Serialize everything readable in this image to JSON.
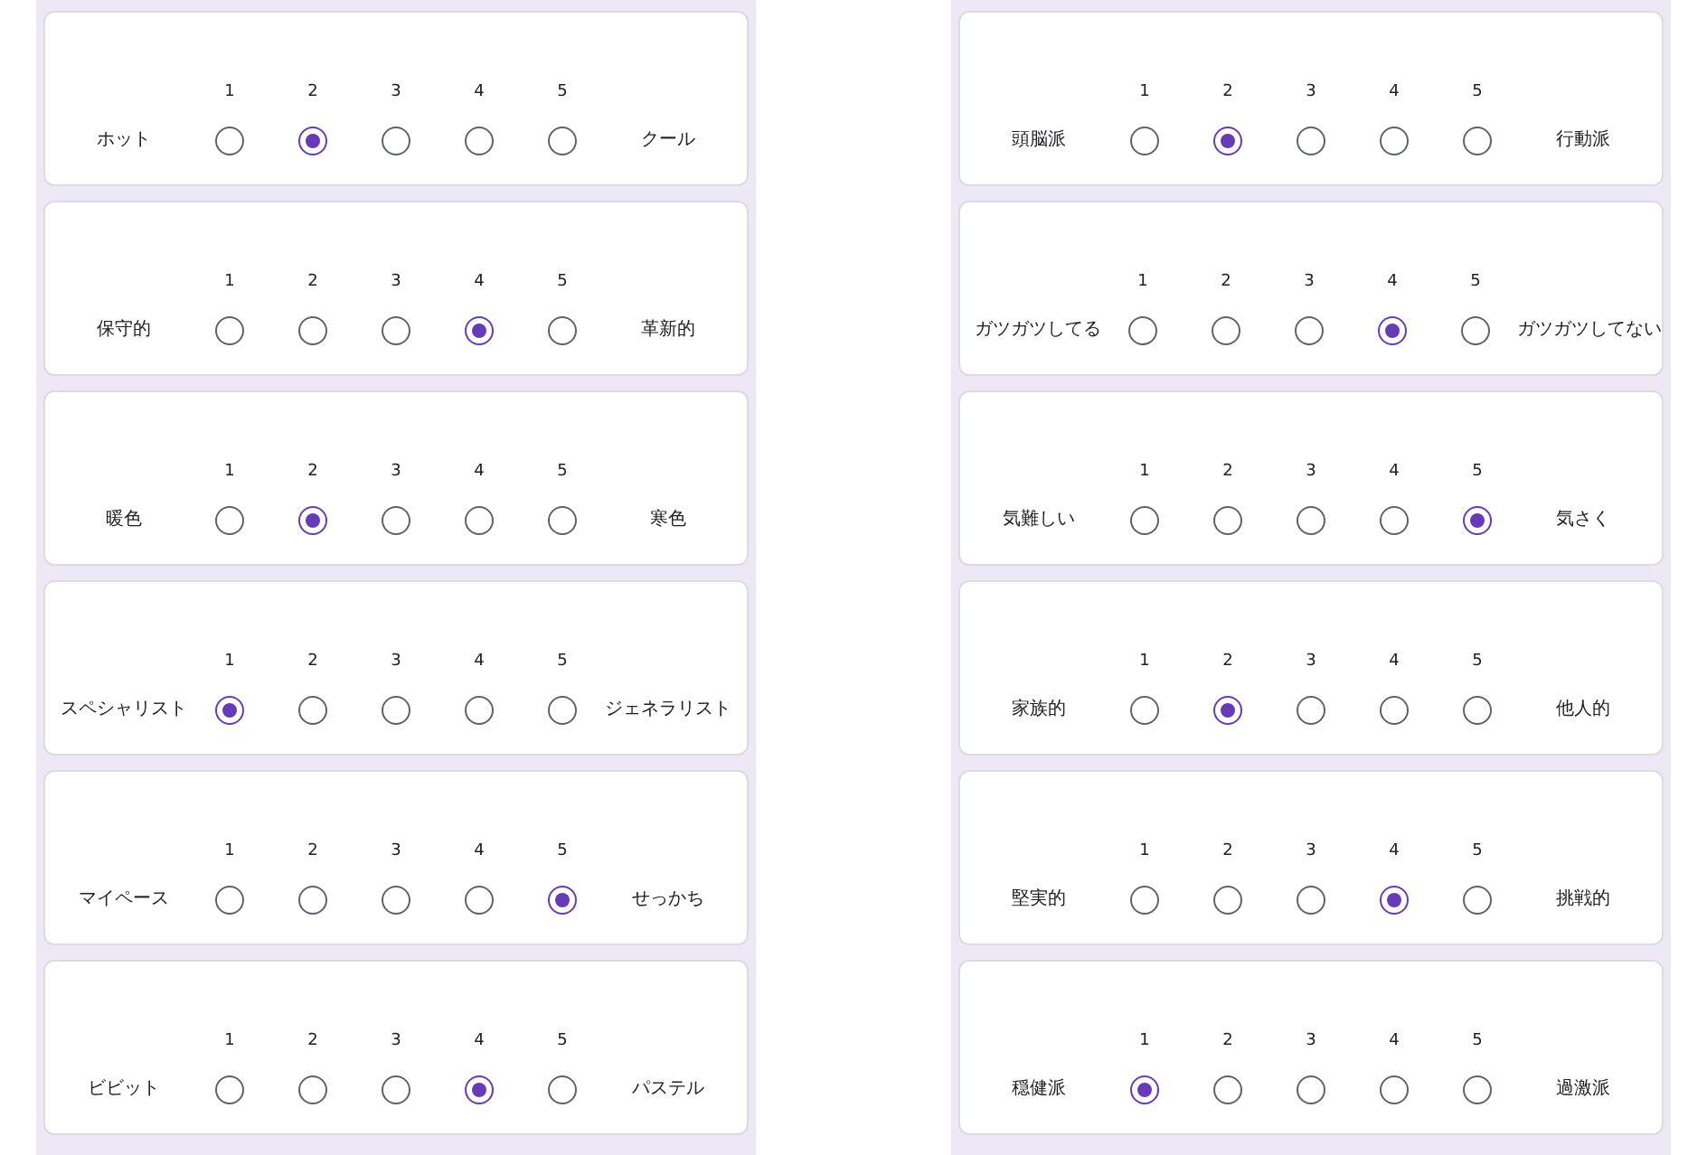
{
  "columns": [
    {
      "cards": [
        {
          "left": "ホット",
          "right": "クール",
          "options": [
            {
              "label": "1",
              "selected": false
            },
            {
              "label": "2",
              "selected": true
            },
            {
              "label": "3",
              "selected": false
            },
            {
              "label": "4",
              "selected": false
            },
            {
              "label": "5",
              "selected": false
            }
          ]
        },
        {
          "left": "保守的",
          "right": "革新的",
          "options": [
            {
              "label": "1",
              "selected": false
            },
            {
              "label": "2",
              "selected": false
            },
            {
              "label": "3",
              "selected": false
            },
            {
              "label": "4",
              "selected": true
            },
            {
              "label": "5",
              "selected": false
            }
          ]
        },
        {
          "left": "暖色",
          "right": "寒色",
          "options": [
            {
              "label": "1",
              "selected": false
            },
            {
              "label": "2",
              "selected": true
            },
            {
              "label": "3",
              "selected": false
            },
            {
              "label": "4",
              "selected": false
            },
            {
              "label": "5",
              "selected": false
            }
          ]
        },
        {
          "left": "スペシャリスト",
          "right": "ジェネラリスト",
          "options": [
            {
              "label": "1",
              "selected": true
            },
            {
              "label": "2",
              "selected": false
            },
            {
              "label": "3",
              "selected": false
            },
            {
              "label": "4",
              "selected": false
            },
            {
              "label": "5",
              "selected": false
            }
          ]
        },
        {
          "left": "マイペース",
          "right": "せっかち",
          "options": [
            {
              "label": "1",
              "selected": false
            },
            {
              "label": "2",
              "selected": false
            },
            {
              "label": "3",
              "selected": false
            },
            {
              "label": "4",
              "selected": false
            },
            {
              "label": "5",
              "selected": true
            }
          ]
        },
        {
          "left": "ビビット",
          "right": "パステル",
          "options": [
            {
              "label": "1",
              "selected": false
            },
            {
              "label": "2",
              "selected": false
            },
            {
              "label": "3",
              "selected": false
            },
            {
              "label": "4",
              "selected": true
            },
            {
              "label": "5",
              "selected": false
            }
          ]
        }
      ]
    },
    {
      "cards": [
        {
          "left": "頭脳派",
          "right": "行動派",
          "options": [
            {
              "label": "1",
              "selected": false
            },
            {
              "label": "2",
              "selected": true
            },
            {
              "label": "3",
              "selected": false
            },
            {
              "label": "4",
              "selected": false
            },
            {
              "label": "5",
              "selected": false
            }
          ]
        },
        {
          "left": "ガツガツしてる",
          "right": "ガツガツしてない",
          "options": [
            {
              "label": "1",
              "selected": false
            },
            {
              "label": "2",
              "selected": false
            },
            {
              "label": "3",
              "selected": false
            },
            {
              "label": "4",
              "selected": true
            },
            {
              "label": "5",
              "selected": false
            }
          ]
        },
        {
          "left": "気難しい",
          "right": "気さく",
          "options": [
            {
              "label": "1",
              "selected": false
            },
            {
              "label": "2",
              "selected": false
            },
            {
              "label": "3",
              "selected": false
            },
            {
              "label": "4",
              "selected": false
            },
            {
              "label": "5",
              "selected": true
            }
          ]
        },
        {
          "left": "家族的",
          "right": "他人的",
          "options": [
            {
              "label": "1",
              "selected": false
            },
            {
              "label": "2",
              "selected": true
            },
            {
              "label": "3",
              "selected": false
            },
            {
              "label": "4",
              "selected": false
            },
            {
              "label": "5",
              "selected": false
            }
          ]
        },
        {
          "left": "堅実的",
          "right": "挑戦的",
          "options": [
            {
              "label": "1",
              "selected": false
            },
            {
              "label": "2",
              "selected": false
            },
            {
              "label": "3",
              "selected": false
            },
            {
              "label": "4",
              "selected": true
            },
            {
              "label": "5",
              "selected": false
            }
          ]
        },
        {
          "left": "穏健派",
          "right": "過激派",
          "options": [
            {
              "label": "1",
              "selected": true
            },
            {
              "label": "2",
              "selected": false
            },
            {
              "label": "3",
              "selected": false
            },
            {
              "label": "4",
              "selected": false
            },
            {
              "label": "5",
              "selected": false
            }
          ]
        }
      ]
    }
  ]
}
